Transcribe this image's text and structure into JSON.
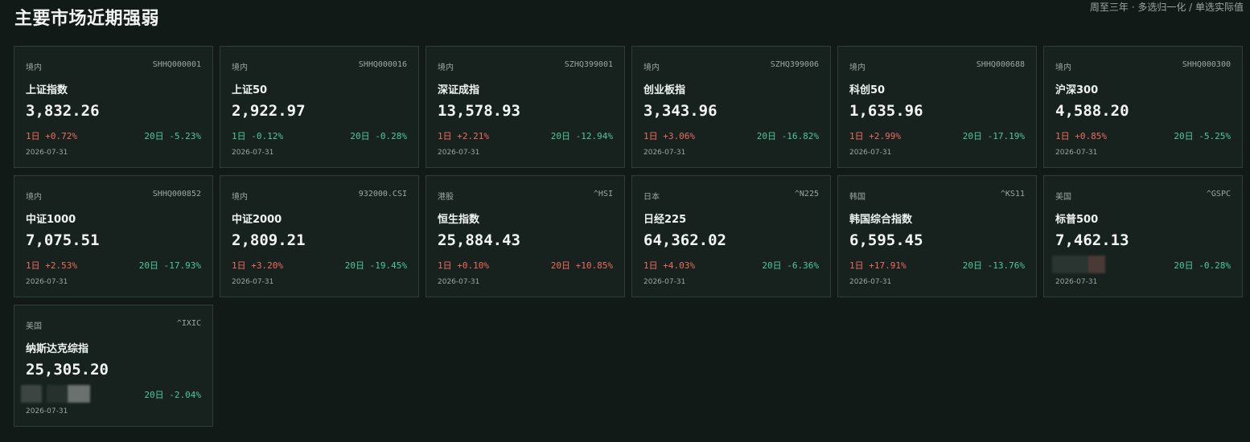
{
  "header": {
    "title": "主要市场近期强弱",
    "subtitle": "周至三年 · 多选归一化 / 单选实际值"
  },
  "colors": {
    "background": "#121a17",
    "card_bg": "#17221e",
    "card_border": "#2d3d37",
    "up": "#f06a5e",
    "down": "#4fc89a"
  },
  "cards": [
    {
      "region": "境内",
      "code": "SHHQ000001",
      "name": "上证指数",
      "price": "3,832.26",
      "chg1d": "1日 +0.72%",
      "dir1d": "up",
      "chg20d": "20日 -5.23%",
      "dir20d": "down",
      "date": "2026-07-31"
    },
    {
      "region": "境内",
      "code": "SHHQ000016",
      "name": "上证50",
      "price": "2,922.97",
      "chg1d": "1日 -0.12%",
      "dir1d": "down",
      "chg20d": "20日 -0.28%",
      "dir20d": "down",
      "date": "2026-07-31"
    },
    {
      "region": "境内",
      "code": "SZHQ399001",
      "name": "深证成指",
      "price": "13,578.93",
      "chg1d": "1日 +2.21%",
      "dir1d": "up",
      "chg20d": "20日 -12.94%",
      "dir20d": "down",
      "date": "2026-07-31"
    },
    {
      "region": "境内",
      "code": "SZHQ399006",
      "name": "创业板指",
      "price": "3,343.96",
      "chg1d": "1日 +3.06%",
      "dir1d": "up",
      "chg20d": "20日 -16.82%",
      "dir20d": "down",
      "date": "2026-07-31"
    },
    {
      "region": "境内",
      "code": "SHHQ000688",
      "name": "科创50",
      "price": "1,635.96",
      "chg1d": "1日 +2.99%",
      "dir1d": "up",
      "chg20d": "20日 -17.19%",
      "dir20d": "down",
      "date": "2026-07-31"
    },
    {
      "region": "境内",
      "code": "SHHQ000300",
      "name": "沪深300",
      "price": "4,588.20",
      "chg1d": "1日 +0.85%",
      "dir1d": "up",
      "chg20d": "20日 -5.25%",
      "dir20d": "down",
      "date": "2026-07-31"
    },
    {
      "region": "境内",
      "code": "SHHQ000852",
      "name": "中证1000",
      "price": "7,075.51",
      "chg1d": "1日 +2.53%",
      "dir1d": "up",
      "chg20d": "20日 -17.93%",
      "dir20d": "down",
      "date": "2026-07-31"
    },
    {
      "region": "境内",
      "code": "932000.CSI",
      "name": "中证2000",
      "price": "2,809.21",
      "chg1d": "1日 +3.20%",
      "dir1d": "up",
      "chg20d": "20日 -19.45%",
      "dir20d": "down",
      "date": "2026-07-31"
    },
    {
      "region": "港股",
      "code": "^HSI",
      "name": "恒生指数",
      "price": "25,884.43",
      "chg1d": "1日 +0.10%",
      "dir1d": "up",
      "chg20d": "20日 +10.85%",
      "dir20d": "up",
      "date": "2026-07-31"
    },
    {
      "region": "日本",
      "code": "^N225",
      "name": "日经225",
      "price": "64,362.02",
      "chg1d": "1日 +4.03%",
      "dir1d": "up",
      "chg20d": "20日 -6.36%",
      "dir20d": "down",
      "date": "2026-07-31"
    },
    {
      "region": "韩国",
      "code": "^KS11",
      "name": "韩国综合指数",
      "price": "6,595.45",
      "chg1d": "1日 +17.91%",
      "dir1d": "up",
      "chg20d": "20日 -13.76%",
      "dir20d": "down",
      "date": "2026-07-31"
    },
    {
      "region": "美国",
      "code": "^GSPC",
      "name": "标普500",
      "price": "7,462.13",
      "chg1d": "",
      "dir1d": "redacted",
      "chg20d": "20日 -0.28%",
      "dir20d": "down",
      "date": "2026-07-31"
    },
    {
      "region": "美国",
      "code": "^IXIC",
      "name": "纳斯达克综指",
      "price": "25,305.20",
      "chg1d": "",
      "dir1d": "redacted",
      "chg20d": "20日 -2.04%",
      "dir20d": "down",
      "date": "2026-07-31"
    }
  ]
}
